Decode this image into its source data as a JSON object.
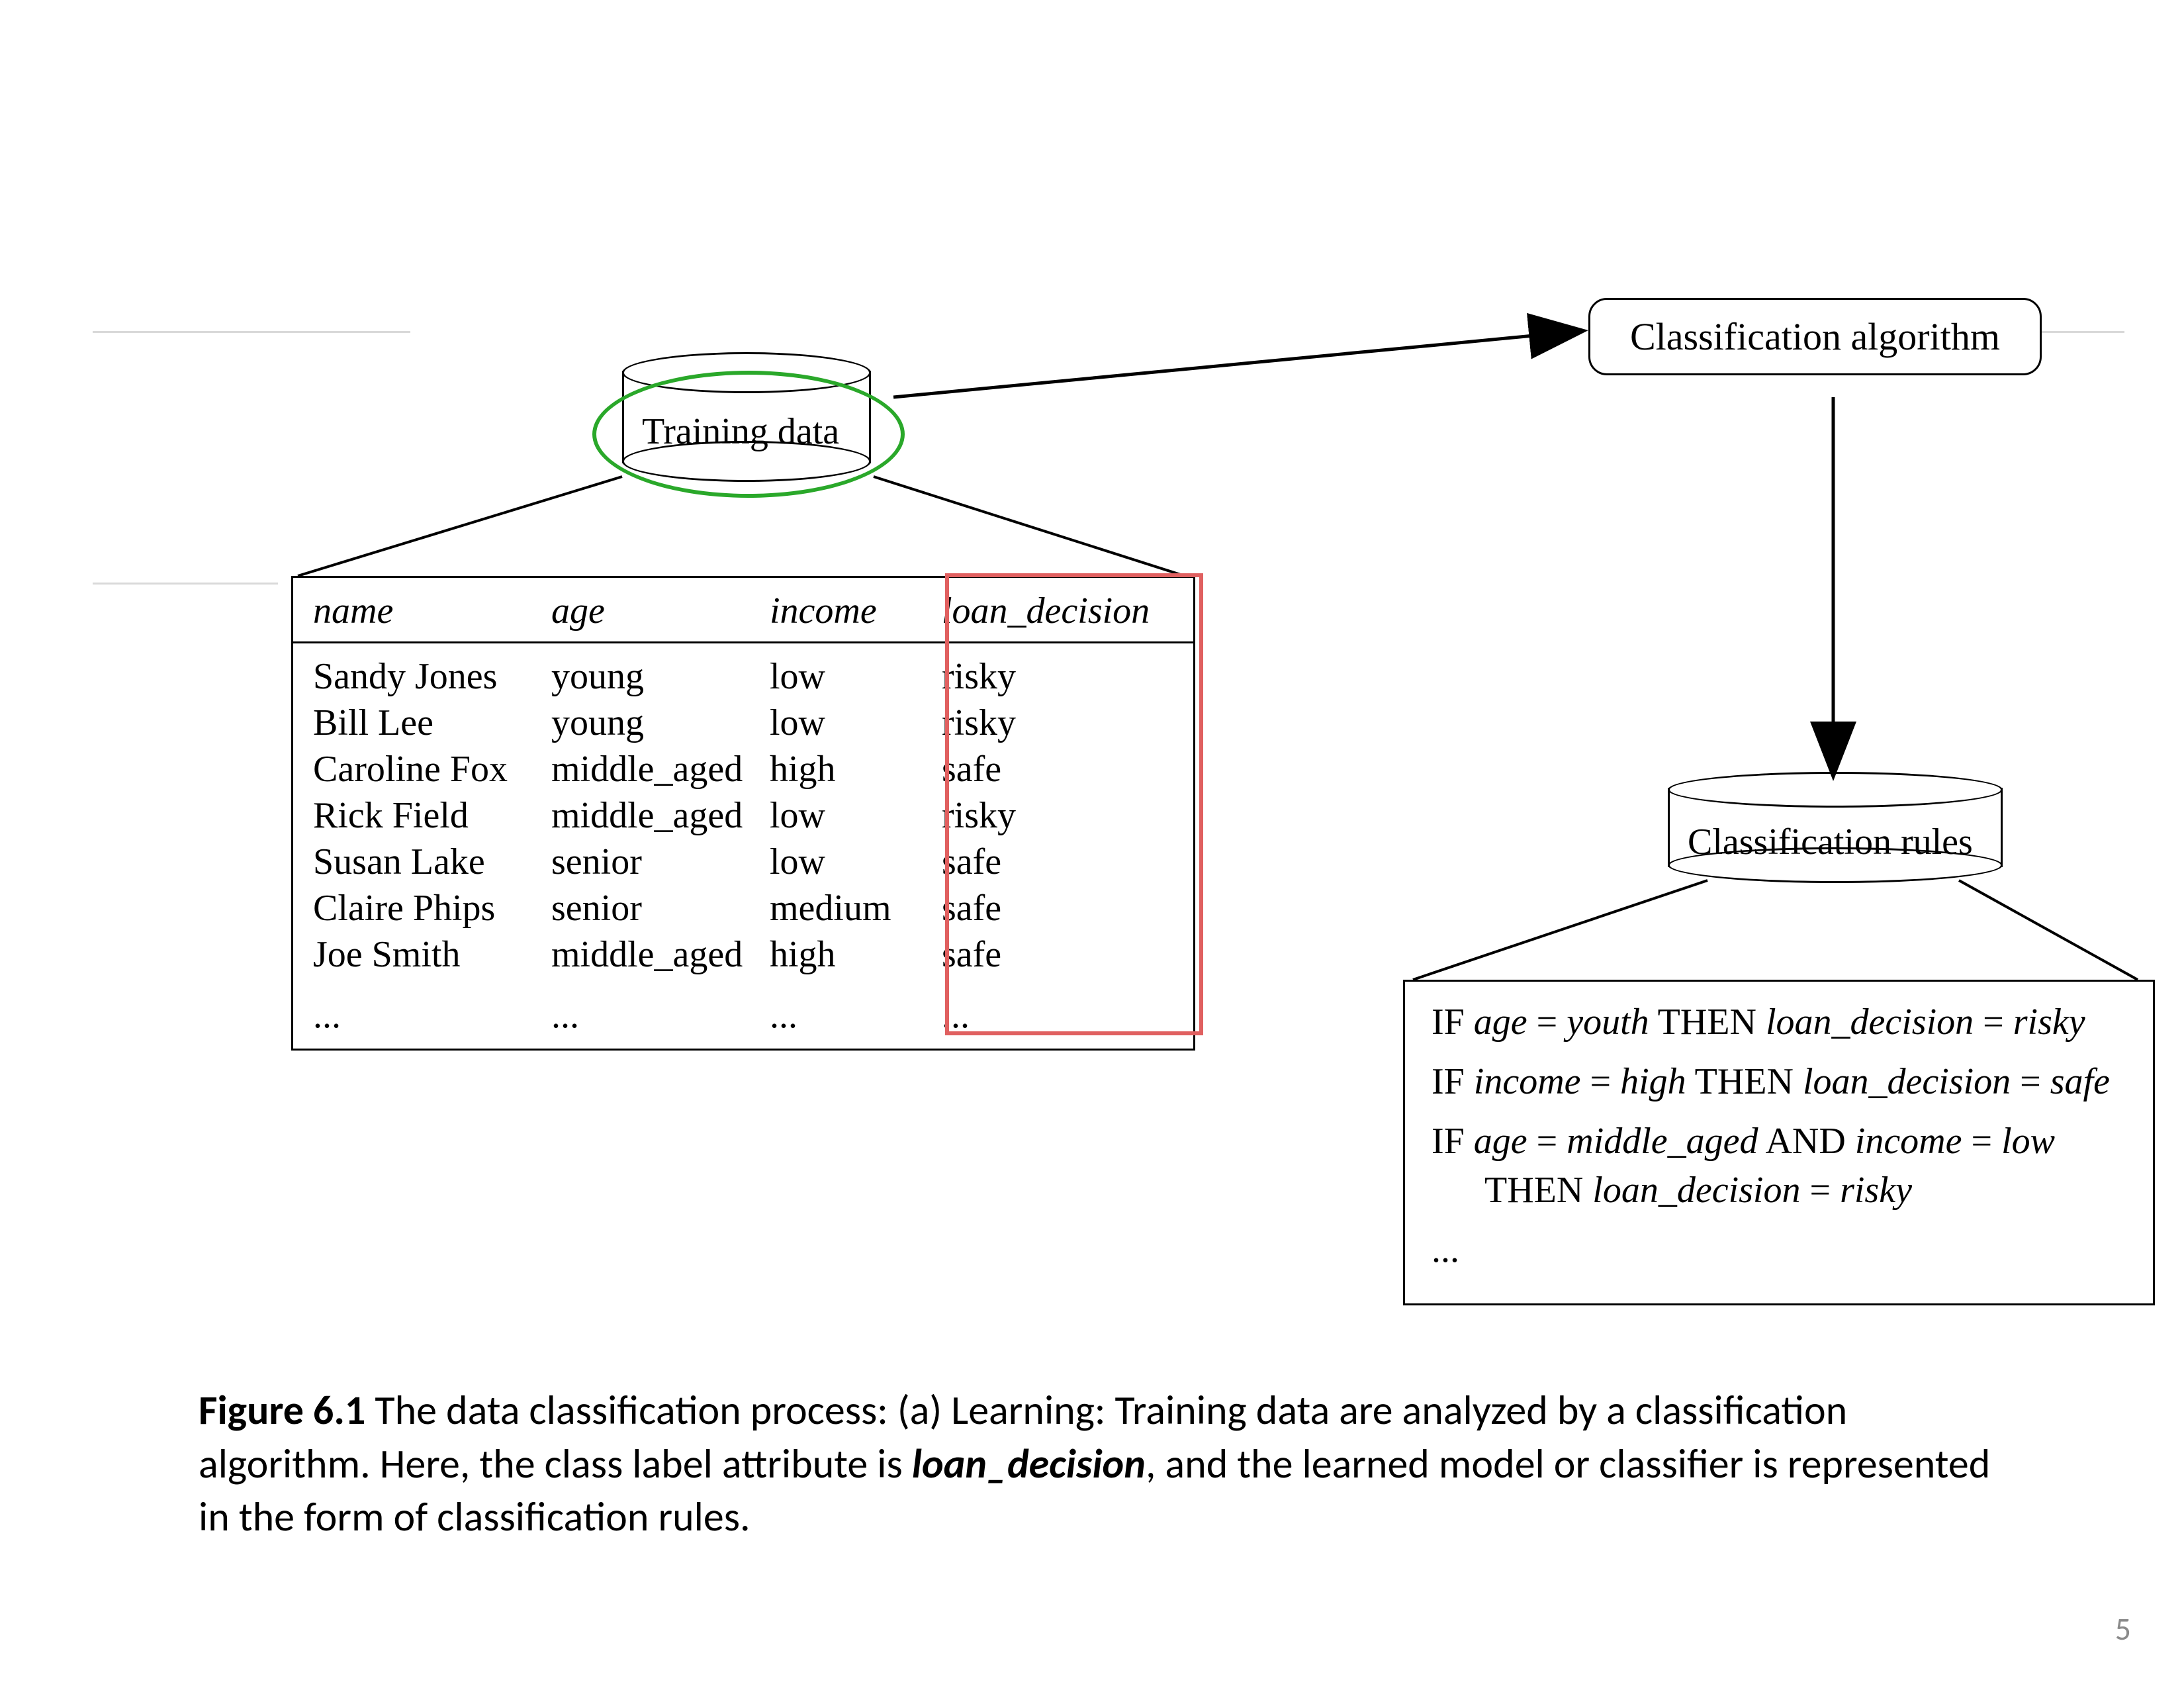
{
  "diagram": {
    "trainingDataLabel": "Training data",
    "algorithmLabel": "Classification algorithm",
    "rulesCylinderLabel": "Classification rules"
  },
  "table": {
    "headers": {
      "c1": "name",
      "c2": "age",
      "c3": "income",
      "c4": "loan_decision"
    },
    "rows": [
      {
        "c1": "Sandy Jones",
        "c2": "young",
        "c3": "low",
        "c4": "risky"
      },
      {
        "c1": "Bill Lee",
        "c2": "young",
        "c3": "low",
        "c4": "risky"
      },
      {
        "c1": "Caroline Fox",
        "c2": "middle_aged",
        "c3": "high",
        "c4": "safe"
      },
      {
        "c1": "Rick Field",
        "c2": "middle_aged",
        "c3": "low",
        "c4": "risky"
      },
      {
        "c1": "Susan Lake",
        "c2": "senior",
        "c3": "low",
        "c4": "safe"
      },
      {
        "c1": "Claire Phips",
        "c2": "senior",
        "c3": "medium",
        "c4": "safe"
      },
      {
        "c1": "Joe Smith",
        "c2": "middle_aged",
        "c3": "high",
        "c4": "safe"
      }
    ],
    "ellipsis": {
      "c1": "...",
      "c2": "...",
      "c3": "...",
      "c4": "..."
    }
  },
  "rules": {
    "r1": {
      "if": "IF ",
      "v1a": "age",
      "eq1": " = ",
      "v1b": "youth",
      "then": " THEN ",
      "v2a": "loan_decision",
      "eq2": " = ",
      "v2b": "risky"
    },
    "r2": {
      "if": "IF ",
      "v1a": "income",
      "eq1": " = ",
      "v1b": "high",
      "then": " THEN ",
      "v2a": "loan_decision",
      "eq2": " = ",
      "v2b": "safe"
    },
    "r3a": {
      "if": "IF ",
      "v1a": "age",
      "eq1": " = ",
      "v1b": "middle_aged",
      "and": " AND ",
      "v2a": "income",
      "eq2": " = ",
      "v2b": "low"
    },
    "r3b": {
      "then": "THEN ",
      "v1a": "loan_decision",
      "eq1": " = ",
      "v1b": "risky"
    },
    "ellipsis": "..."
  },
  "caption": {
    "label": "Figure 6.1",
    "text1": "  The data classification process: (a) Learning: Training data are analyzed by a classification algorithm. Here, the class label attribute is ",
    "emph": "loan_decision",
    "text2": ", and the learned model or classifier is represented in the form of classification rules."
  },
  "pageNumber": "5"
}
